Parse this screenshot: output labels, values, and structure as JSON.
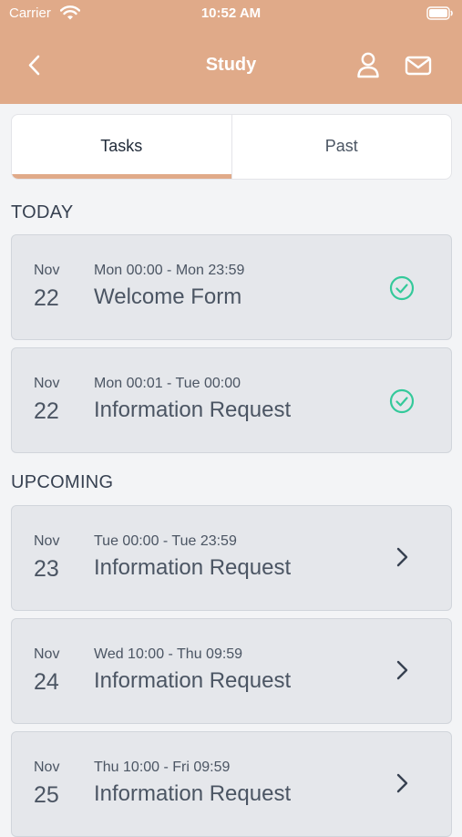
{
  "status_bar": {
    "carrier": "Carrier",
    "time": "10:52 AM"
  },
  "nav": {
    "title": "Study"
  },
  "tabs": [
    {
      "label": "Tasks",
      "active": true
    },
    {
      "label": "Past",
      "active": false
    }
  ],
  "sections": {
    "today": {
      "title": "TODAY",
      "items": [
        {
          "month": "Nov",
          "day": "22",
          "range": "Mon 00:00 - Mon 23:59",
          "title": "Welcome Form",
          "status": "completed"
        },
        {
          "month": "Nov",
          "day": "22",
          "range": "Mon 00:01 - Tue 00:00",
          "title": "Information Request",
          "status": "completed"
        }
      ]
    },
    "upcoming": {
      "title": "UPCOMING",
      "items": [
        {
          "month": "Nov",
          "day": "23",
          "range": "Tue 00:00 - Tue 23:59",
          "title": "Information Request",
          "status": "upcoming"
        },
        {
          "month": "Nov",
          "day": "24",
          "range": "Wed 10:00 - Thu 09:59",
          "title": "Information Request",
          "status": "upcoming"
        },
        {
          "month": "Nov",
          "day": "25",
          "range": "Thu 10:00 - Fri 09:59",
          "title": "Information Request",
          "status": "upcoming"
        }
      ]
    }
  },
  "colors": {
    "accent": "#e0aa89",
    "check": "#34c99a",
    "card": "#e5e7eb",
    "text": "#4b5563"
  }
}
